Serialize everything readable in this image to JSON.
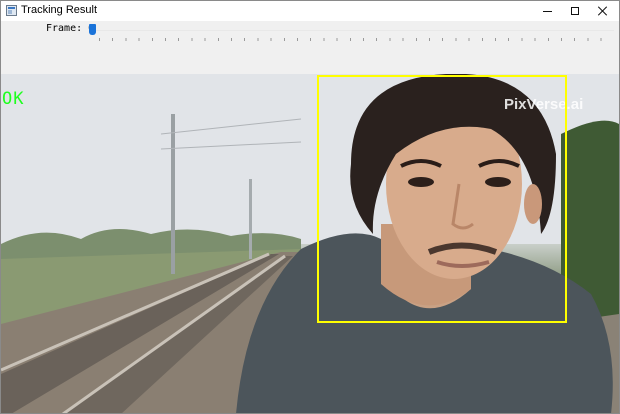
{
  "window": {
    "title": "Tracking Result",
    "icons": {
      "app": "app-window-icon",
      "minimize": "minimize-icon",
      "maximize": "maximize-icon",
      "close": "close-icon"
    }
  },
  "trackbar": {
    "label": "Frame: 0",
    "value": 0,
    "thumb_color": "#1a73d9"
  },
  "video": {
    "status_text": "OK",
    "status_color": "#1eff1e",
    "watermark": "PixVerse.ai",
    "bbox_color": "#ffff00"
  }
}
